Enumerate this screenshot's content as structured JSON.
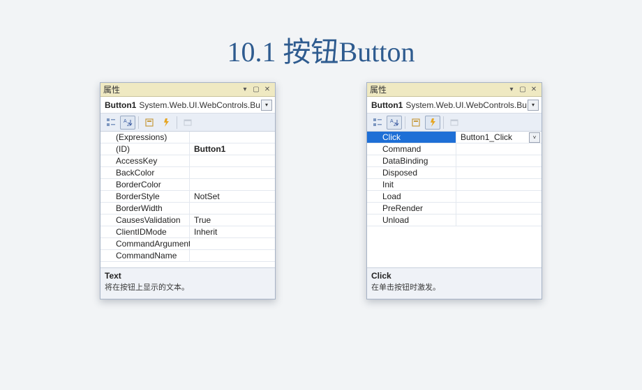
{
  "page_title": "10.1 按钮Button",
  "left_panel": {
    "titlebar": "属性",
    "object_name": "Button1",
    "object_type": "System.Web.UI.WebControls.Bu",
    "properties": [
      {
        "name": "(Expressions)",
        "value": ""
      },
      {
        "name": "(ID)",
        "value": "Button1",
        "bold": true
      },
      {
        "name": "AccessKey",
        "value": ""
      },
      {
        "name": "BackColor",
        "value": ""
      },
      {
        "name": "BorderColor",
        "value": ""
      },
      {
        "name": "BorderStyle",
        "value": "NotSet"
      },
      {
        "name": "BorderWidth",
        "value": ""
      },
      {
        "name": "CausesValidation",
        "value": "True"
      },
      {
        "name": "ClientIDMode",
        "value": "Inherit"
      },
      {
        "name": "CommandArgument",
        "value": ""
      },
      {
        "name": "CommandName",
        "value": ""
      }
    ],
    "desc_title": "Text",
    "desc_text": "将在按钮上显示的文本。"
  },
  "right_panel": {
    "titlebar": "属性",
    "object_name": "Button1",
    "object_type": "System.Web.UI.WebControls.Bu",
    "events": [
      {
        "name": "Click",
        "value": "Button1_Click",
        "selected": true,
        "dropdown": true
      },
      {
        "name": "Command",
        "value": ""
      },
      {
        "name": "DataBinding",
        "value": ""
      },
      {
        "name": "Disposed",
        "value": ""
      },
      {
        "name": "Init",
        "value": ""
      },
      {
        "name": "Load",
        "value": ""
      },
      {
        "name": "PreRender",
        "value": ""
      },
      {
        "name": "Unload",
        "value": ""
      }
    ],
    "desc_title": "Click",
    "desc_text": "在单击按钮时激发。"
  }
}
